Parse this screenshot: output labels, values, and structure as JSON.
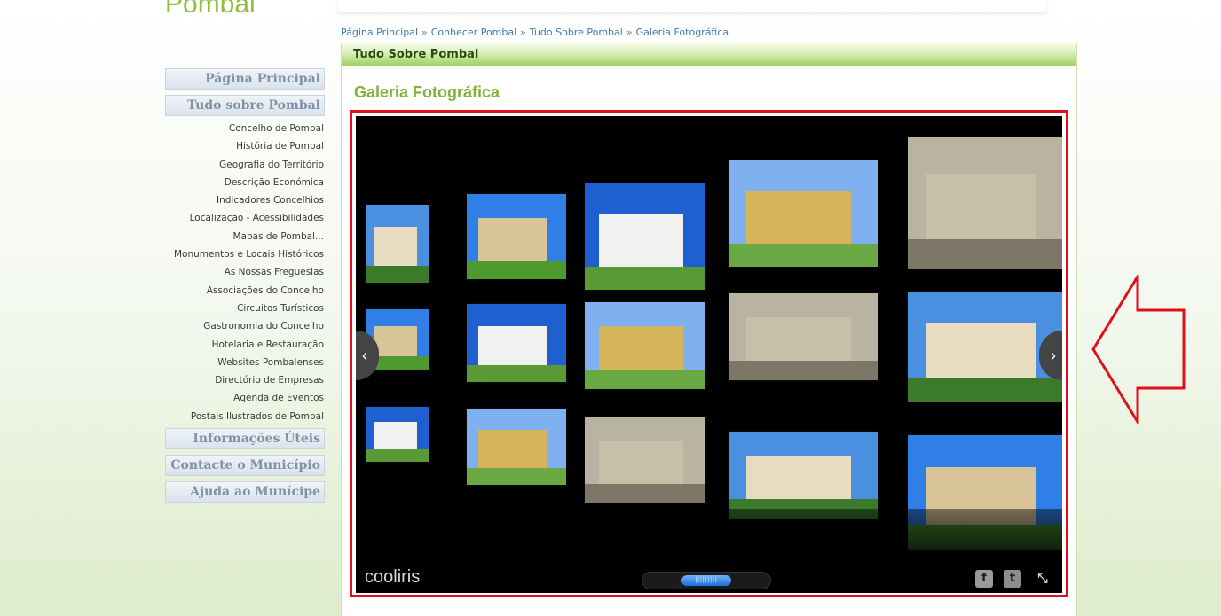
{
  "site": {
    "logo_text": "Pombal"
  },
  "breadcrumb": {
    "items": [
      "Página Principal",
      "Conhecer Pombal",
      "Tudo Sobre Pombal",
      "Galeria Fotográfica"
    ],
    "separator": "»"
  },
  "sidebar": {
    "header_main": "Página Principal",
    "header_about": "Tudo sobre Pombal",
    "links": [
      "Concelho de Pombal",
      "História de Pombal",
      "Geografia do Território",
      "Descrição Económica",
      "Indicadores Concelhios",
      "Localização - Acessibilidades",
      "Mapas de Pombal...",
      "Monumentos e Locais Históricos",
      "As Nossas Freguesias",
      "Associações do Concelho",
      "Circuitos Turísticos",
      "Gastronomia do Concelho",
      "Hotelaria e Restauração",
      "Websites Pombalenses",
      "Directório de Empresas",
      "Agenda de Eventos",
      "Postais Ilustrados de Pombal"
    ],
    "header_info": "Informações Úteis",
    "header_contact": "Contacte o Município",
    "header_help": "Ajuda ao Munícipe"
  },
  "content": {
    "section_title": "Tudo Sobre Pombal",
    "page_title": "Galeria Fotográfica"
  },
  "gallery": {
    "brand": "cooliris",
    "prev_icon": "chevron-left-icon",
    "next_icon": "chevron-right-icon",
    "prev_glyph": "‹",
    "next_glyph": "›",
    "thumb_glyph": "|||||||||",
    "facebook_glyph": "f",
    "twitter_glyph": "t",
    "fullscreen_glyph": "⤡",
    "photo_count": 15
  },
  "colors": {
    "accent_green": "#7fb236",
    "breadcrumb_link": "#3c7bb5",
    "highlight_red": "#e0101a"
  }
}
